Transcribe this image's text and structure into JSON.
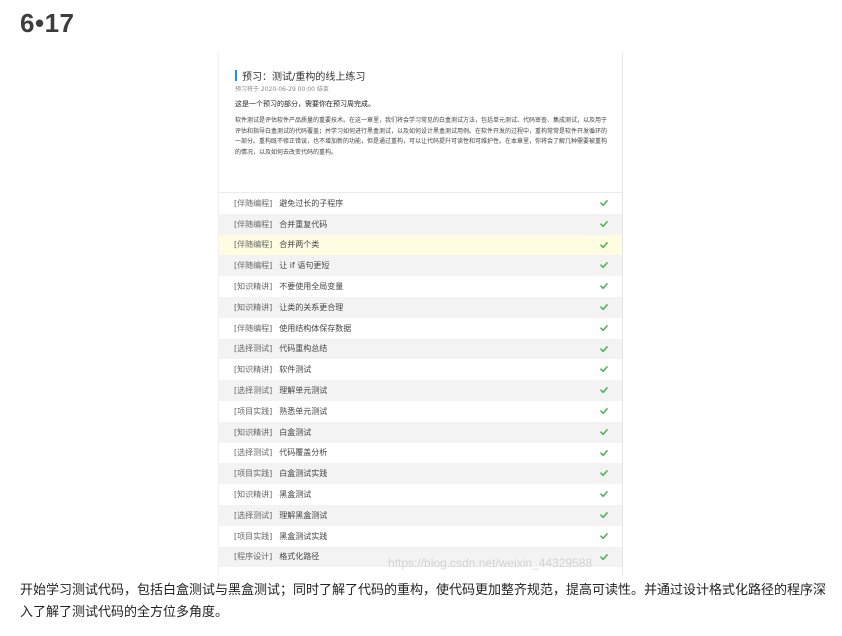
{
  "blog": {
    "heading": "6•17",
    "summary": "开始学习测试代码，包括白盒测试与黑盒测试；同时了解了代码的重构，使代码更加整齐规范，提高可读性。并通过设计格式化路径的程序深入了解了测试代码的全方位多角度。",
    "watermark": "https://blog.csdn.net/weixin_44329588"
  },
  "screenshot": {
    "title": "预习：测试/重构的线上练习",
    "deadline": "预习将于 2020-06-29 00:00 结束",
    "notice": "这是一个预习的部分，需要你在预习周完成。",
    "description": "软件测试是评估软件产品质量的重要技术。在这一章里，我们将会学习常见的白盒测试方法，包括单元测试、代码审查、集成测试，以及用于评估和指导白盒测试的代码覆盖；并学习如何进行黑盒测试，以及如何设计黑盒测试用例。在软件开发的过程中，重构常常是软件开发循环的一部分。重构既不修正错误，也不增加新的功能，但是通过重构，可以让代码提升可读性和可维护性。在本章里，你将会了解几种需要被重构的情况，以及如何去改变代码的重构。",
    "accent_color": "#1890ff",
    "check_color": "#52b35c",
    "icon": "check-icon",
    "tasks": [
      {
        "category": "[伴随编程]",
        "name": "避免过长的子程序"
      },
      {
        "category": "[伴随编程]",
        "name": "合并重复代码"
      },
      {
        "category": "[伴随编程]",
        "name": "合并两个类"
      },
      {
        "category": "[伴随编程]",
        "name": "让 if 语句更短"
      },
      {
        "category": "[知识精讲]",
        "name": "不要使用全局变量"
      },
      {
        "category": "[知识精讲]",
        "name": "让类的关系更合理"
      },
      {
        "category": "[伴随编程]",
        "name": "使用结构体保存数据"
      },
      {
        "category": "[选择测试]",
        "name": "代码重构总结"
      },
      {
        "category": "[知识精讲]",
        "name": "软件测试"
      },
      {
        "category": "[选择测试]",
        "name": "理解单元测试"
      },
      {
        "category": "[项目实践]",
        "name": "熟悉单元测试"
      },
      {
        "category": "[知识精讲]",
        "name": "白盒测试"
      },
      {
        "category": "[选择测试]",
        "name": "代码覆盖分析"
      },
      {
        "category": "[项目实践]",
        "name": "白盒测试实践"
      },
      {
        "category": "[知识精讲]",
        "name": "黑盒测试"
      },
      {
        "category": "[选择测试]",
        "name": "理解黑盒测试"
      },
      {
        "category": "[项目实践]",
        "name": "黑盒测试实践"
      },
      {
        "category": "[程序设计]",
        "name": "格式化路径"
      }
    ]
  }
}
